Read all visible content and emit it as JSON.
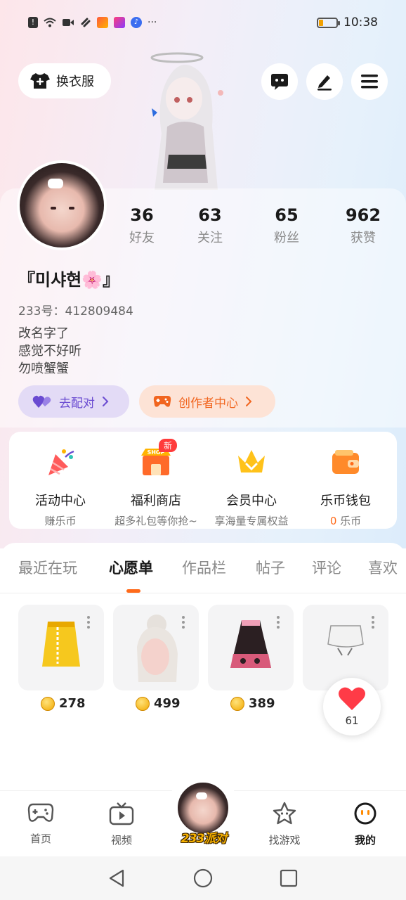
{
  "status_bar": {
    "time": "10:38",
    "more": "···",
    "icons": [
      "alert-icon",
      "wifi-icon",
      "video-icon",
      "link-icon",
      "app-icon",
      "lala-icon",
      "music-icon"
    ],
    "battery_level": 0.2
  },
  "header": {
    "outfit_label": "换衣服",
    "buttons": [
      "chat-icon",
      "edit-icon",
      "menu-icon"
    ]
  },
  "profile": {
    "stats": [
      {
        "value": "36",
        "label": "好友"
      },
      {
        "value": "63",
        "label": "关注"
      },
      {
        "value": "65",
        "label": "粉丝"
      },
      {
        "value": "962",
        "label": "获赞"
      }
    ],
    "username": "『미샤현🌸』",
    "uid": "233号：412809484",
    "bio": [
      "改名字了",
      "感觉不好听",
      "勿喷蟹蟹"
    ],
    "match_label": "去配对",
    "creator_label": "创作者中心"
  },
  "features": {
    "new_badge": "新",
    "shop_sign": "SHOP",
    "items": [
      {
        "title": "活动中心",
        "sub": "赚乐币"
      },
      {
        "title": "福利商店",
        "sub": "超多礼包等你抢~"
      },
      {
        "title": "会员中心",
        "sub": "享海量专属权益"
      },
      {
        "title": "乐币钱包",
        "sub_count": "0",
        "sub_unit": " 乐币"
      }
    ]
  },
  "tabs": [
    "最近在玩",
    "心愿单",
    "作品栏",
    "帖子",
    "评论",
    "喜欢"
  ],
  "active_tab": 1,
  "wishlist": [
    {
      "price": "278"
    },
    {
      "price": "499"
    },
    {
      "price": "389"
    }
  ],
  "like_float": {
    "count": "61"
  },
  "bottom_nav": {
    "items": [
      {
        "label": "首页",
        "icon": "gamepad-icon"
      },
      {
        "label": "视频",
        "icon": "tv-play-icon"
      },
      {
        "label": "找游戏",
        "icon": "star-icon"
      },
      {
        "label": "我的",
        "icon": "smile-face-icon"
      }
    ],
    "center_label": "233派对"
  },
  "colors": {
    "accent_orange": "#ff6a1a",
    "match_purple": "#6a4bd1",
    "creator_orange": "#f1651f"
  }
}
